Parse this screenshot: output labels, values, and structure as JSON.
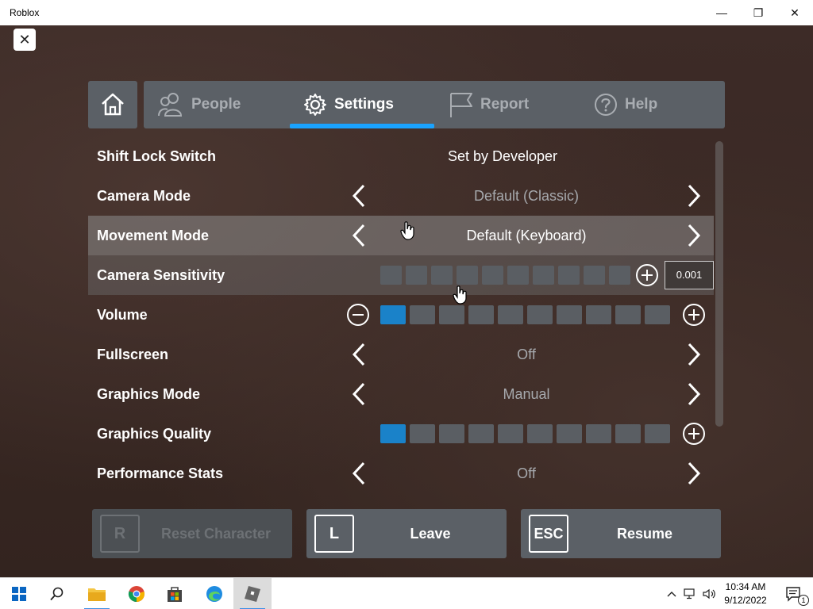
{
  "window": {
    "title": "Roblox",
    "minimize": "—",
    "restore": "❐",
    "close": "✕"
  },
  "menu": {
    "close_glyph": "✕",
    "tabs": [
      {
        "label": "People",
        "icon": "people-icon",
        "active": false
      },
      {
        "label": "Settings",
        "icon": "gear-icon",
        "active": true
      },
      {
        "label": "Report",
        "icon": "flag-icon",
        "active": false
      },
      {
        "label": "Help",
        "icon": "help-icon",
        "active": false
      }
    ],
    "accent_color": "#1aa3ff"
  },
  "settings": {
    "shift_lock": {
      "label": "Shift Lock Switch",
      "value": "Set by Developer"
    },
    "camera_mode": {
      "label": "Camera Mode",
      "value": "Default (Classic)"
    },
    "movement_mode": {
      "label": "Movement Mode",
      "value": "Default (Keyboard)"
    },
    "camera_sensitivity": {
      "label": "Camera Sensitivity",
      "value": "0.001",
      "level": 0,
      "steps": 10
    },
    "volume": {
      "label": "Volume",
      "level": 1,
      "steps": 10
    },
    "fullscreen": {
      "label": "Fullscreen",
      "value": "Off"
    },
    "graphics_mode": {
      "label": "Graphics Mode",
      "value": "Manual"
    },
    "graphics_quality": {
      "label": "Graphics Quality",
      "level": 1,
      "steps": 10
    },
    "performance_stats": {
      "label": "Performance Stats",
      "value": "Off"
    }
  },
  "buttons": {
    "reset": {
      "key": "R",
      "label": "Reset Character",
      "enabled": false
    },
    "leave": {
      "key": "L",
      "label": "Leave"
    },
    "resume": {
      "key": "ESC",
      "label": "Resume"
    }
  },
  "taskbar": {
    "apps": [
      "windows-start-icon",
      "search-icon",
      "file-explorer-icon",
      "chrome-icon",
      "store-icon",
      "edge-icon",
      "roblox-icon"
    ],
    "time": "10:34 AM",
    "date": "9/12/2022",
    "notification_count": "1"
  }
}
